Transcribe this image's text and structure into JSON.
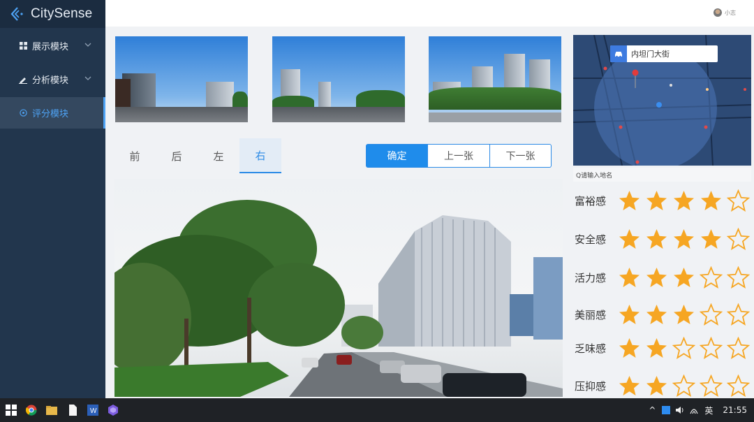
{
  "app": {
    "name": "CitySense"
  },
  "sidebar": {
    "items": [
      {
        "label": "展示模块",
        "icon": "grid-icon"
      },
      {
        "label": "分析模块",
        "icon": "pen-icon"
      },
      {
        "label": "评分模块",
        "icon": "target-icon",
        "active": true
      }
    ]
  },
  "header": {
    "user_name": "小志"
  },
  "directions": {
    "tabs": [
      "前",
      "后",
      "左",
      "右"
    ],
    "active": "右"
  },
  "buttons": {
    "confirm": "确定",
    "previous": "上一张",
    "next": "下一张"
  },
  "map": {
    "popup_label": "内坦门大街",
    "search_placeholder": "Q请输入地名"
  },
  "ratings": [
    {
      "label": "富裕感",
      "stars": 4,
      "max": 5
    },
    {
      "label": "安全感",
      "stars": 4,
      "max": 5
    },
    {
      "label": "活力感",
      "stars": 3,
      "max": 5
    },
    {
      "label": "美丽感",
      "stars": 3,
      "max": 5
    },
    {
      "label": "乏味感",
      "stars": 2,
      "max": 5
    },
    {
      "label": "压抑感",
      "stars": 2,
      "max": 5
    }
  ],
  "taskbar": {
    "ime": "英",
    "time": "21:55"
  },
  "colors": {
    "sidebar_bg": "#22364d",
    "accent": "#2b8ae6",
    "star_filled": "#f6a623",
    "star_empty": "#f6a623"
  }
}
